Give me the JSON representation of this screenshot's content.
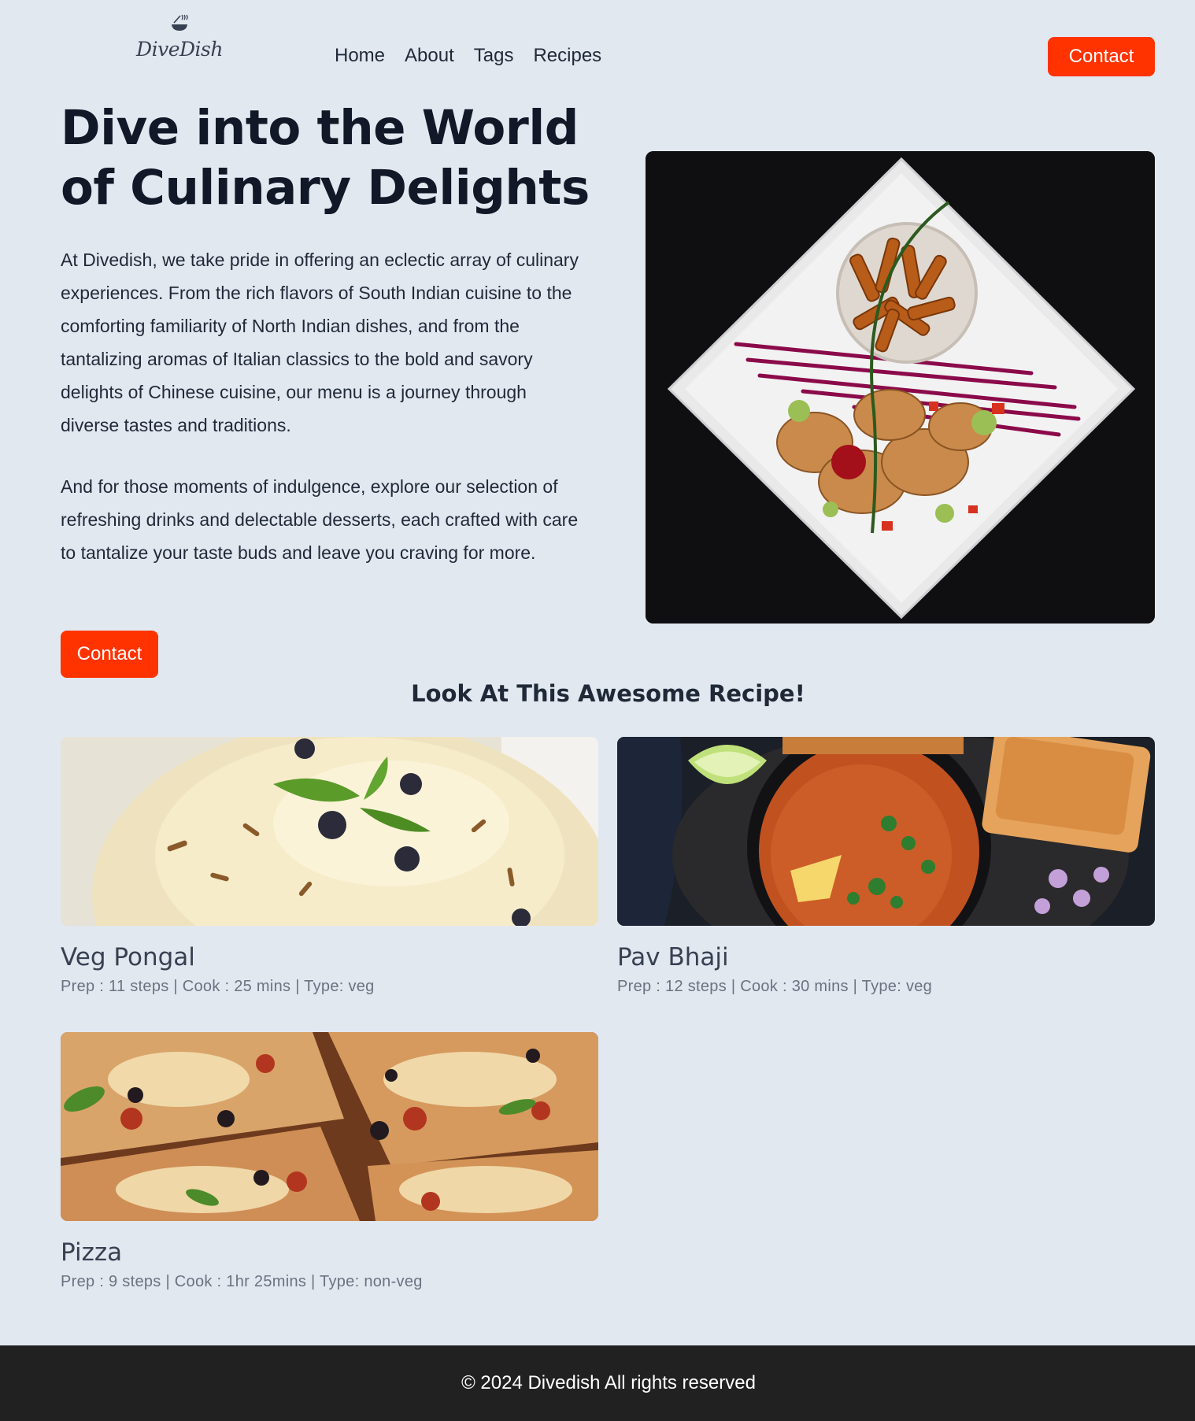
{
  "brand": {
    "name": "DiveDish",
    "icon": "chef-bowl-icon"
  },
  "nav": {
    "items": [
      "Home",
      "About",
      "Tags",
      "Recipes"
    ]
  },
  "header": {
    "contact_label": "Contact"
  },
  "hero": {
    "title": "Dive into the World of Culinary Delights",
    "paragraph1": "At Divedish, we take pride in offering an eclectic array of culinary experiences. From the rich flavors of South Indian cuisine to the comforting familiarity of North Indian dishes, and from the tantalizing aromas of Italian classics to the bold and savory delights of Chinese cuisine, our menu is a journey through diverse tastes and traditions.",
    "paragraph2": "And for those moments of indulgence, explore our selection of refreshing drinks and delectable desserts, each crafted with care to tantalize your taste buds and leave you craving for more.",
    "contact_label": "Contact"
  },
  "recipes": {
    "title": "Look At This Awesome Recipe!",
    "items": [
      {
        "name": "Veg Pongal",
        "meta": "Prep : 11 steps | Cook : 25 mins | Type: veg"
      },
      {
        "name": "Pav Bhaji",
        "meta": "Prep : 12 steps | Cook : 30 mins | Type: veg"
      },
      {
        "name": "Pizza",
        "meta": "Prep : 9 steps | Cook : 1hr 25mins | Type: non-veg"
      }
    ]
  },
  "footer": {
    "text": "© 2024 Divedish All rights reserved"
  },
  "colors": {
    "accent": "#ff3300",
    "background": "#e2e8f0",
    "footer": "#212121"
  }
}
